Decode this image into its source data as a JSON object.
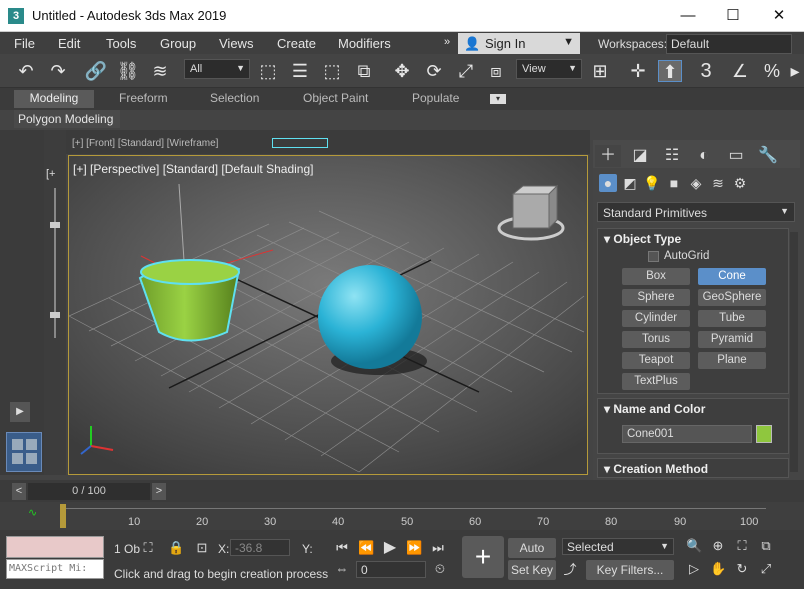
{
  "window": {
    "title": "Untitled - Autodesk 3ds Max 2019",
    "app_icon": "3"
  },
  "menu": [
    "File",
    "Edit",
    "Tools",
    "Group",
    "Views",
    "Create",
    "Modifiers"
  ],
  "signin": {
    "label": "Sign In"
  },
  "workspaces": {
    "label": "Workspaces:",
    "value": "Default"
  },
  "toolbar": {
    "selection_filter": "All",
    "view_select": "View",
    "snap_label": "3"
  },
  "ribbon": {
    "tabs": [
      "Modeling",
      "Freeform",
      "Selection",
      "Object Paint",
      "Populate"
    ],
    "active": "Modeling",
    "subtab": "Polygon Modeling"
  },
  "viewport": {
    "label": "[+] [Perspective] [Standard] [Default Shading]",
    "top_tabs": "[+] [Front] [Standard] [Wireframe]"
  },
  "command_panel": {
    "primitive_type": "Standard Primitives",
    "object_type": {
      "title": "Object Type",
      "autogrid": "AutoGrid",
      "buttons": [
        "Box",
        "Cone",
        "Sphere",
        "GeoSphere",
        "Cylinder",
        "Tube",
        "Torus",
        "Pyramid",
        "Teapot",
        "Plane",
        "TextPlus"
      ],
      "active": "Cone"
    },
    "name_color": {
      "title": "Name and Color",
      "name": "Cone001",
      "color": "#8fc73e"
    },
    "creation_method": {
      "title": "Creation Method"
    }
  },
  "timeline": {
    "frame": "0 / 100",
    "ticks": [
      "10",
      "20",
      "30",
      "40",
      "50",
      "60",
      "70",
      "80",
      "90",
      "100"
    ]
  },
  "status": {
    "maxscript_placeholder": "MAXScript Mi:",
    "selected_count": "1 Ob",
    "prompt": "Click and drag to begin creation process",
    "x_label": "X:",
    "x_value": "-36.8",
    "y_label": "Y:",
    "frame_value": "0",
    "auto_key": "Auto Key",
    "set_key": "Set Key",
    "key_mode": "Selected",
    "key_filters": "Key Filters..."
  },
  "colors": {
    "accent": "#5b8fc9",
    "cone": "#8fc73e",
    "sphere": "#2bb3d6",
    "selection": "#5fe0f0"
  }
}
